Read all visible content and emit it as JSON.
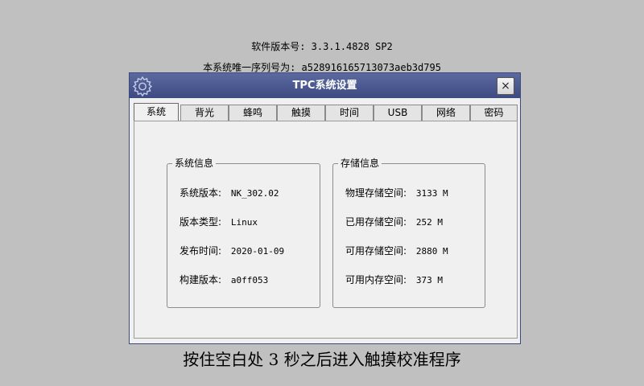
{
  "header": {
    "software_version": "软件版本号: 3.3.1.4828 SP2",
    "serial": "本系统唯一序列号为: a528916165713073aeb3d795"
  },
  "window": {
    "title": "TPC系统设置",
    "close_label": "×"
  },
  "tabs": [
    "系统",
    "背光",
    "蜂鸣",
    "触摸",
    "时间",
    "USB",
    "网络",
    "密码"
  ],
  "system_info": {
    "title": "系统信息",
    "rows": [
      {
        "label": "系统版本:",
        "value": "NK_302.02"
      },
      {
        "label": "版本类型:",
        "value": "Linux"
      },
      {
        "label": "发布时间:",
        "value": "2020-01-09"
      },
      {
        "label": "构建版本:",
        "value": "a0ff053"
      }
    ]
  },
  "storage_info": {
    "title": "存储信息",
    "rows": [
      {
        "label": "物理存储空间:",
        "value": "3133 M"
      },
      {
        "label": "已用存储空间:",
        "value": "252 M"
      },
      {
        "label": "可用存储空间:",
        "value": "2880 M"
      },
      {
        "label": "可用内存空间:",
        "value": "373 M"
      }
    ]
  },
  "footer": {
    "hint": "按住空白处 3 秒之后进入触摸校准程序"
  }
}
